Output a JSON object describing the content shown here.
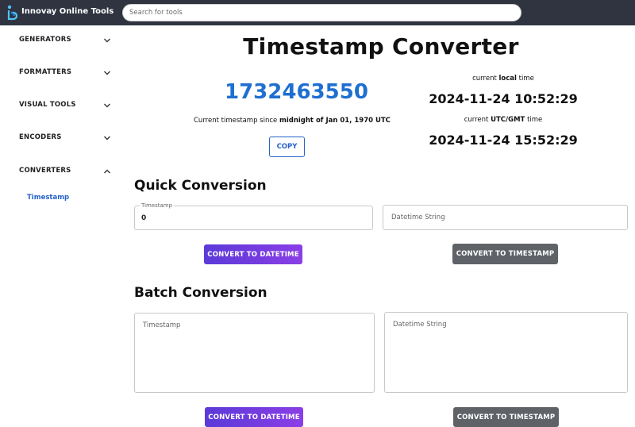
{
  "header": {
    "brand": "Innovay Online Tools",
    "search_placeholder": "Search for tools"
  },
  "sidebar": {
    "items": [
      {
        "label": "GENERATORS",
        "expanded": false
      },
      {
        "label": "FORMATTERS",
        "expanded": false
      },
      {
        "label": "VISUAL TOOLS",
        "expanded": false
      },
      {
        "label": "ENCODERS",
        "expanded": false
      },
      {
        "label": "CONVERTERS",
        "expanded": true
      }
    ],
    "active_subitem": "Timestamp"
  },
  "main": {
    "title": "Timestamp Converter",
    "current_timestamp": "1732463550",
    "caption_prefix": "Current timestamp since",
    "caption_bold": "midnight of Jan 01, 1970 UTC",
    "copy_label": "COPY",
    "local_label_pre": "current",
    "local_label_bold": "local",
    "local_label_post": "time",
    "local_time": "2024-11-24 10:52:29",
    "utc_label_pre": "current",
    "utc_label_bold": "UTC/GMT",
    "utc_label_post": "time",
    "utc_time": "2024-11-24 15:52:29"
  },
  "quick": {
    "title": "Quick Conversion",
    "timestamp_label": "Timestamp",
    "timestamp_value": "0",
    "datetime_placeholder": "Datetime String",
    "to_datetime_label": "CONVERT TO DATETIME",
    "to_timestamp_label": "CONVERT TO TIMESTAMP"
  },
  "batch": {
    "title": "Batch Conversion",
    "timestamp_placeholder": "Timestamp",
    "datetime_placeholder": "Datetime String",
    "to_datetime_label": "CONVERT TO DATETIME",
    "to_timestamp_label": "CONVERT TO TIMESTAMP"
  },
  "colors": {
    "topbar": "#2f3440",
    "accent_blue": "#1f6fd1",
    "button_purple": "#6b3ade",
    "button_gray": "#5f6368"
  },
  "icons": {
    "logo": "innovay-logo-icon",
    "chevron_down": "chevron-down-icon",
    "chevron_up": "chevron-up-icon"
  }
}
